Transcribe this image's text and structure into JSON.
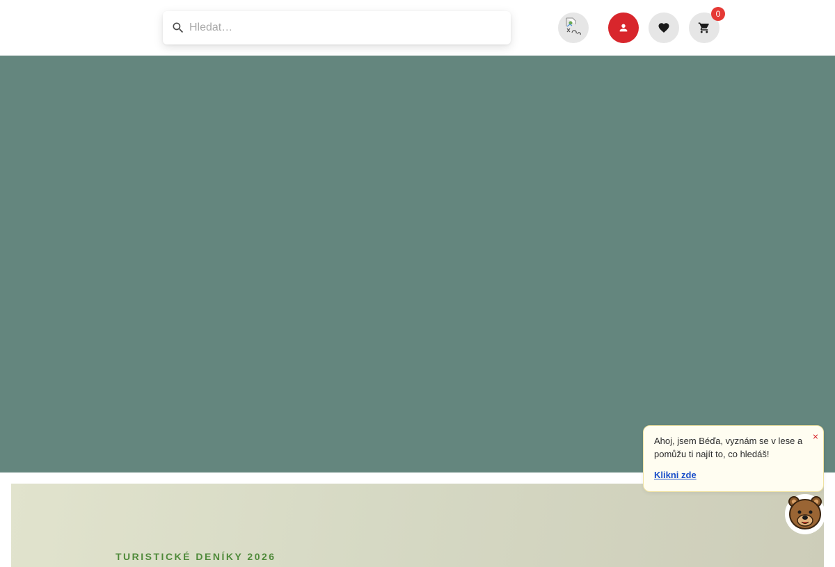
{
  "header": {
    "search": {
      "placeholder": "Hledat…",
      "icon": "search-icon"
    },
    "language_button": {
      "icon": "broken-image-icon"
    },
    "account_button": {
      "icon": "user-icon",
      "color": "#d8262c"
    },
    "wishlist_button": {
      "icon": "heart-icon"
    },
    "cart_button": {
      "icon": "cart-icon",
      "count": "0",
      "badge_color": "#e53935"
    }
  },
  "hero": {
    "background": "#64867e"
  },
  "promo": {
    "title": "TURISTICKÉ DENÍKY 2026",
    "title_color": "#4f8a3a"
  },
  "chat": {
    "message": "Ahoj, jsem Béďa, vyznám se v lese a pomůžu ti najít to, co hledáš!",
    "link_label": "Klikni zde",
    "close_label": "×",
    "avatar_icon": "bear-icon"
  }
}
